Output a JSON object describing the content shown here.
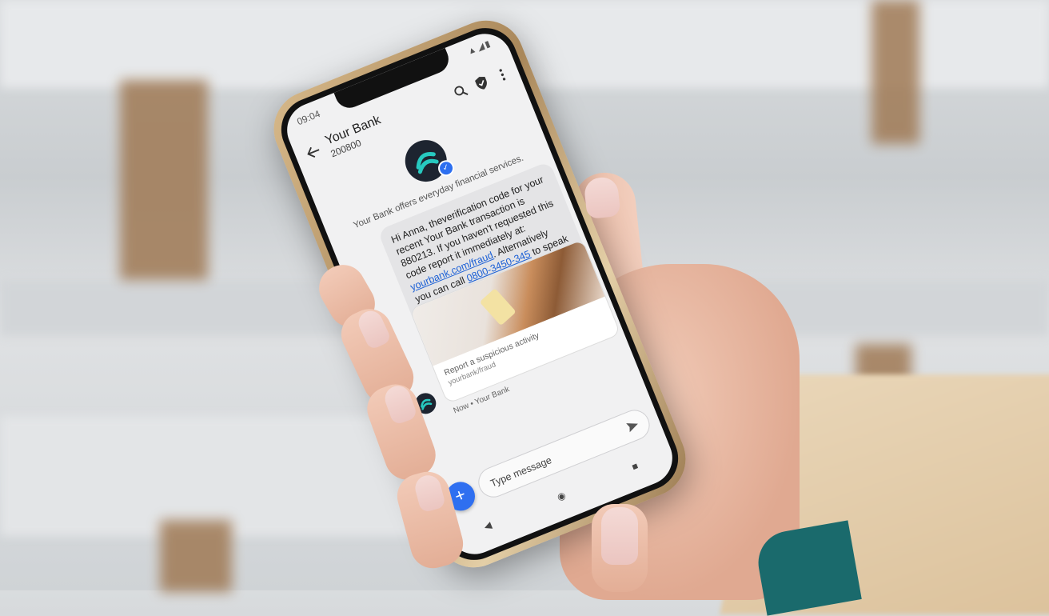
{
  "status": {
    "time": "09:04"
  },
  "conversation": {
    "title": "Your Bank",
    "number": "200800",
    "description": "Your Bank offers everyday financial services."
  },
  "message": {
    "text_before_link": "Hi Anna, theverification code for your recent Your Bank transaction is 880213. If you haven't requested this code report it immediately at: ",
    "link": "yourbank.com/fraud",
    "text_middle": ". Alternatively you can call ",
    "phone": "0800-3450-345",
    "text_after": " to speak to an agent.",
    "card_title": "Report a suspicious activity",
    "card_url": "yourbank/fraud",
    "meta": "Now • Your Bank"
  },
  "composer": {
    "placeholder": "Type message"
  },
  "colors": {
    "accent": "#2f6ff0",
    "link": "#1a5fd6",
    "logo_teal": "#27c9c0"
  }
}
